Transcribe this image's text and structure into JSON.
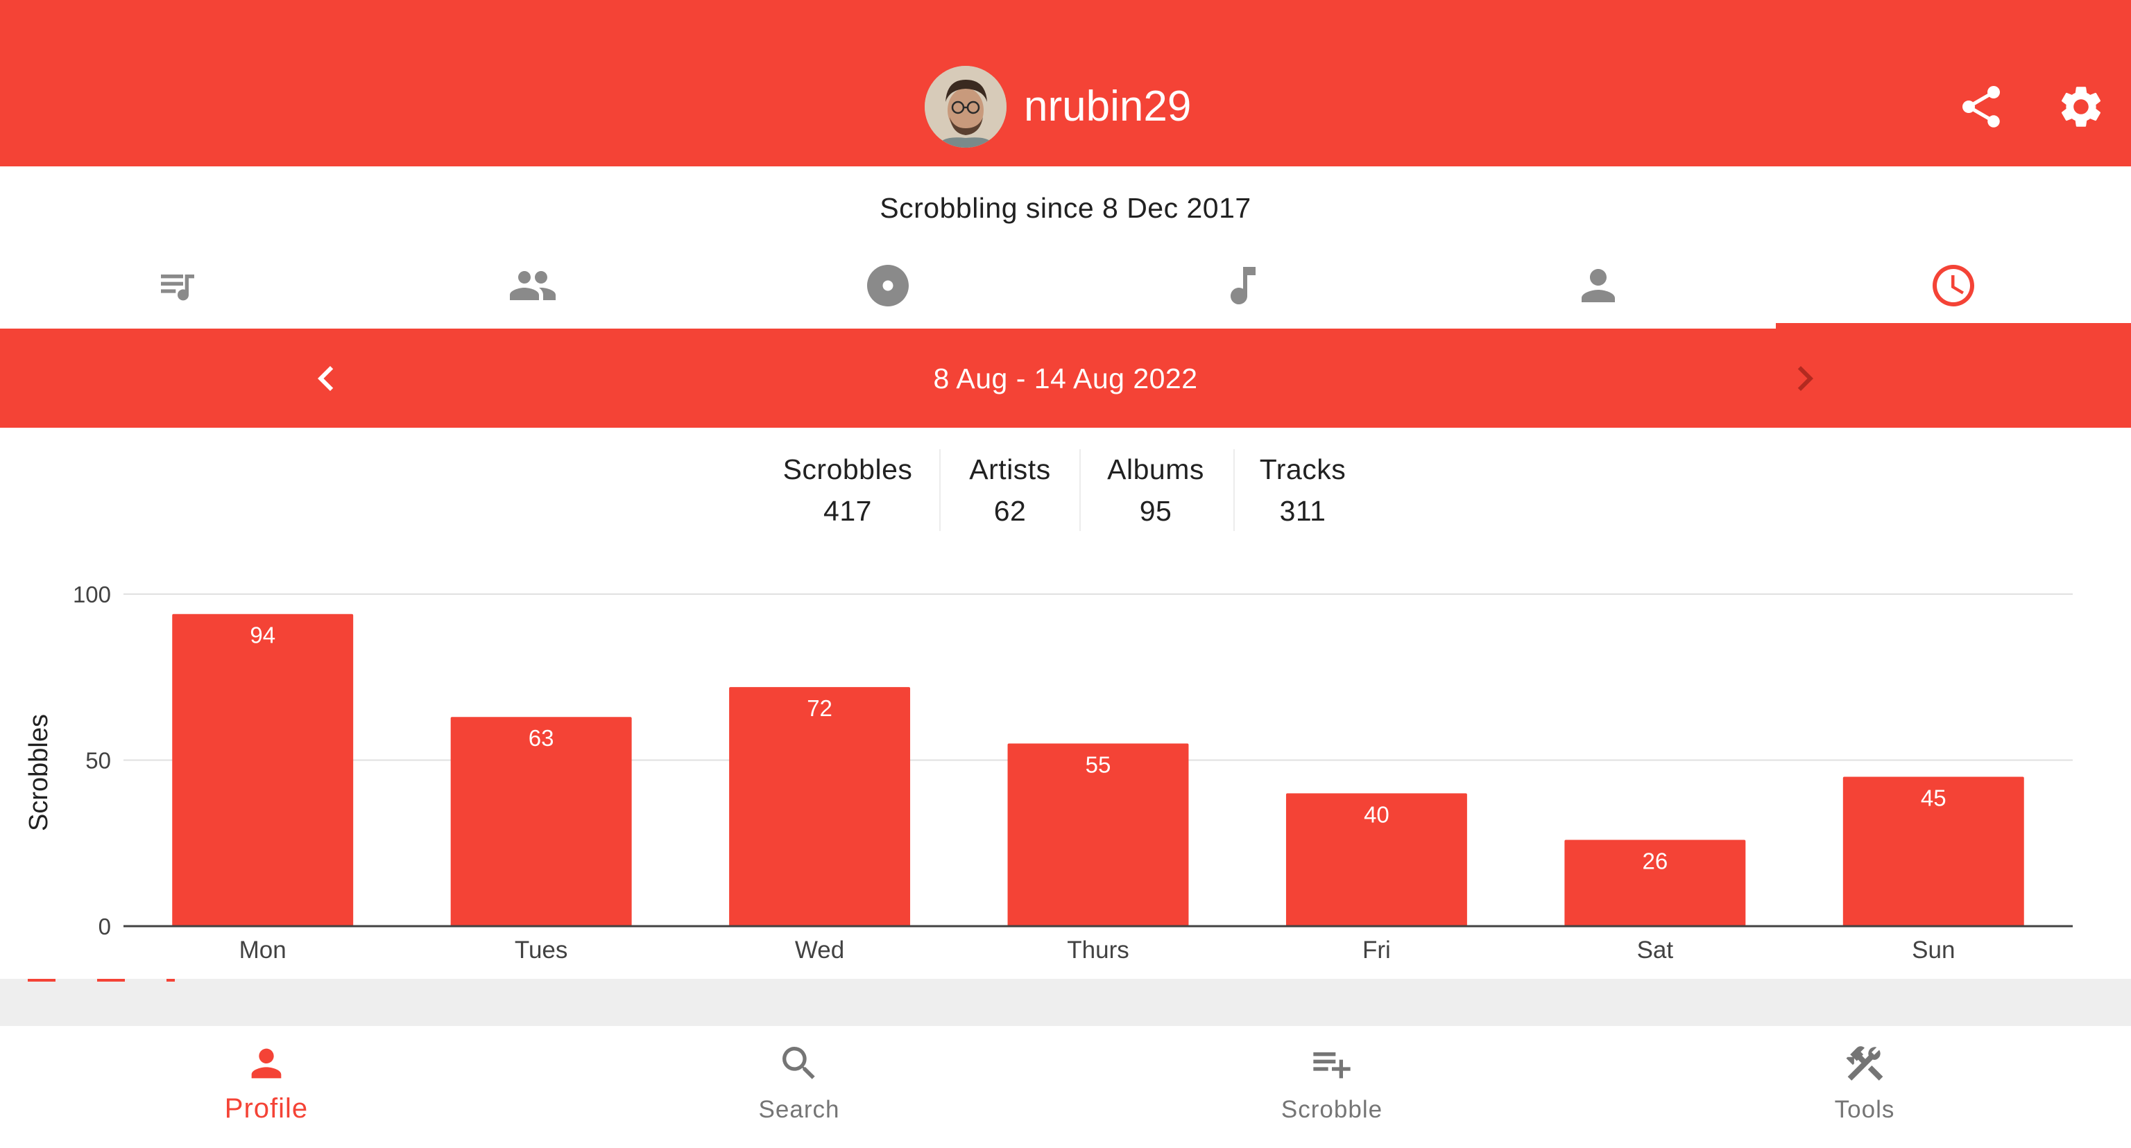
{
  "header": {
    "username": "nrubin29"
  },
  "profile": {
    "since": "Scrobbling since 8 Dec 2017"
  },
  "tabs": [
    {
      "icon": "playlist-icon",
      "active": false
    },
    {
      "icon": "people-icon",
      "active": false
    },
    {
      "icon": "album-icon",
      "active": false
    },
    {
      "icon": "music-note-icon",
      "active": false
    },
    {
      "icon": "person-icon",
      "active": false
    },
    {
      "icon": "clock-icon",
      "active": true
    }
  ],
  "period": {
    "label": "8 Aug - 14 Aug 2022"
  },
  "stats": [
    {
      "label": "Scrobbles",
      "value": "417"
    },
    {
      "label": "Artists",
      "value": "62"
    },
    {
      "label": "Albums",
      "value": "95"
    },
    {
      "label": "Tracks",
      "value": "311"
    }
  ],
  "chart_data": {
    "type": "bar",
    "categories": [
      "Mon",
      "Tues",
      "Wed",
      "Thurs",
      "Fri",
      "Sat",
      "Sun"
    ],
    "values": [
      94,
      63,
      72,
      55,
      40,
      26,
      45
    ],
    "ylabel": "Scrobbles",
    "xlabel": "",
    "ylim": [
      0,
      100
    ],
    "yticks": [
      0,
      50,
      100
    ],
    "grid": true,
    "bar_color": "#f44336"
  },
  "bottom_nav": [
    {
      "label": "Profile",
      "icon": "person-icon",
      "active": true
    },
    {
      "label": "Search",
      "icon": "search-icon",
      "active": false
    },
    {
      "label": "Scrobble",
      "icon": "playlist-add-icon",
      "active": false
    },
    {
      "label": "Tools",
      "icon": "tools-icon",
      "active": false
    }
  ],
  "colors": {
    "accent": "#f44336",
    "inactive_icon": "#8a8a8a",
    "text": "#212121"
  }
}
